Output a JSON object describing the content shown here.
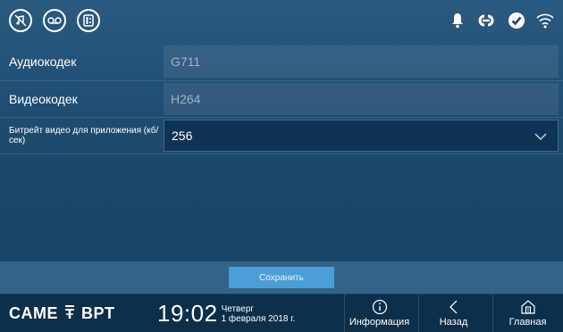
{
  "status_bar": {
    "left_icons": [
      "do-not-disturb-icon",
      "voicemail-icon",
      "intercom-icon"
    ],
    "right_icons": [
      "bell-icon",
      "link-icon",
      "check-circle-icon",
      "wifi-icon"
    ]
  },
  "settings": {
    "audio_codec": {
      "label": "Аудиокодек",
      "value": "G711"
    },
    "video_codec": {
      "label": "Видеокодек",
      "value": "H264"
    },
    "video_bitrate": {
      "label": "Битрейт видео для приложения (кб/сек)",
      "value": "256"
    }
  },
  "save_label": "Сохранить",
  "footer": {
    "brand_left": "CAME",
    "brand_right": "BPT",
    "time": "19:02",
    "day": "Четверг",
    "date": "1 февраля 2018 г.",
    "info_label": "Информация",
    "back_label": "Назад",
    "home_label": "Главная"
  },
  "colors": {
    "background": "#1e4a6e",
    "footer": "#0c2f4b",
    "save_button": "#4c9ed6"
  }
}
